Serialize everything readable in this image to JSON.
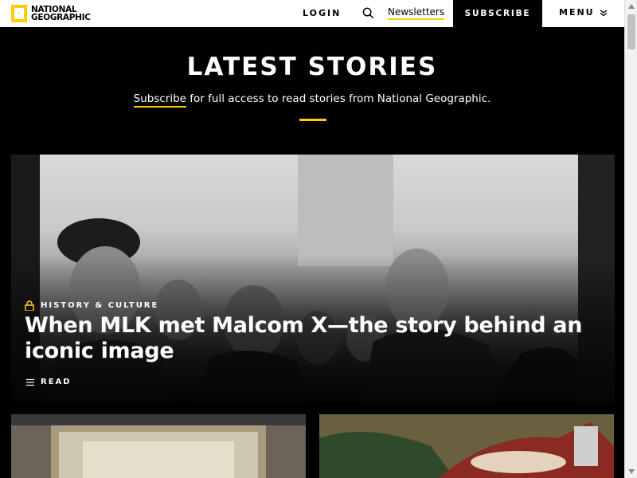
{
  "header": {
    "logo_line1": "NATIONAL",
    "logo_line2": "GEOGRAPHIC",
    "login": "LOGIN",
    "newsletters": "Newsletters",
    "subscribe": "SUBSCRIBE",
    "menu": "MENU",
    "icons": {
      "search": "search-icon",
      "menu": "chevron-down-icon"
    }
  },
  "hero": {
    "title": "LATEST STORIES",
    "subscribe_link": "Subscribe",
    "subtitle_rest": " for full access to read stories from National Geographic."
  },
  "feature": {
    "category": "HISTORY & CULTURE",
    "title": "When MLK met Malcom X—the story behind an iconic image",
    "read_label": "READ",
    "icons": {
      "category": "lock-icon",
      "read": "menu-lines-icon"
    }
  },
  "colors": {
    "accent": "#ffce00",
    "background": "#000000",
    "header_bg": "#ffffff"
  }
}
